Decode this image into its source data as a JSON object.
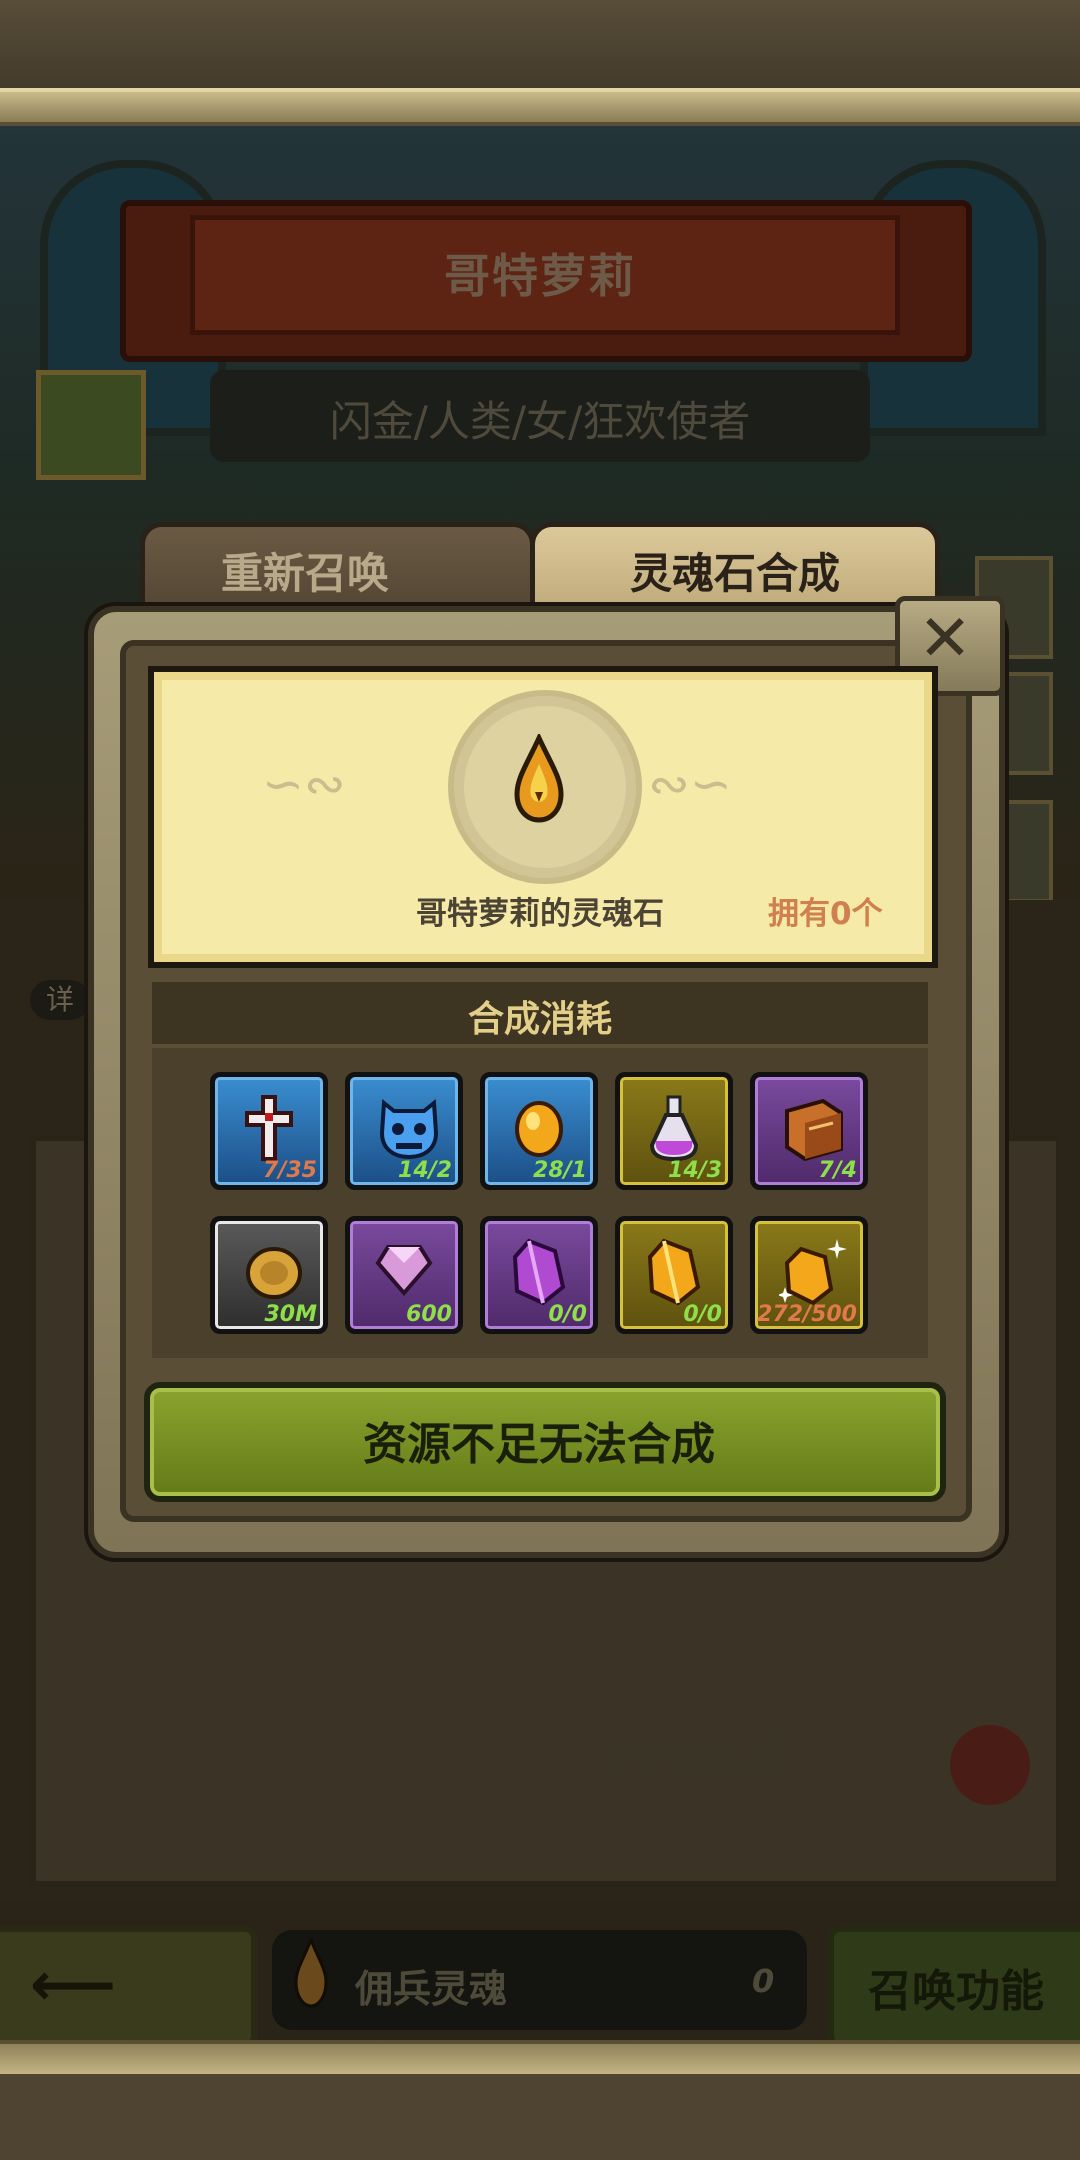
{
  "background": {
    "hero_name": "哥特萝莉",
    "hero_info": "闪金/人类/女/狂欢使者",
    "side_label": "详"
  },
  "tabs": {
    "resummon": "重新召唤",
    "soulstone_craft": "灵魂石合成"
  },
  "modal": {
    "close_label": "✕",
    "stone_name": "哥特萝莉的灵魂石",
    "owned_text": "拥有0个",
    "cost_header": "合成消耗",
    "craft_button": "资源不足无法合成"
  },
  "materials": [
    {
      "icon": "cross-icon",
      "rarity": "blue",
      "count": "7/35",
      "count_color": "red"
    },
    {
      "icon": "skull-icon",
      "rarity": "blue",
      "count": "14/2",
      "count_color": "green"
    },
    {
      "icon": "amber-gem-icon",
      "rarity": "blue",
      "count": "28/1",
      "count_color": "green"
    },
    {
      "icon": "potion-icon",
      "rarity": "gold",
      "count": "14/3",
      "count_color": "green"
    },
    {
      "icon": "book-icon",
      "rarity": "purple",
      "count": "7/4",
      "count_color": "green"
    },
    {
      "icon": "coin-icon",
      "rarity": "gray",
      "count": "30M",
      "count_color": "green"
    },
    {
      "icon": "diamond-icon",
      "rarity": "purple",
      "count": "600",
      "count_color": "green"
    },
    {
      "icon": "purple-crystal-icon",
      "rarity": "purple",
      "count": "0/0",
      "count_color": "green"
    },
    {
      "icon": "gold-crystal-icon",
      "rarity": "gold",
      "count": "0/0",
      "count_color": "green"
    },
    {
      "icon": "sparkle-gold-crystal-icon",
      "rarity": "gold",
      "count": "272/500",
      "count_color": "red"
    }
  ],
  "bottom_bar": {
    "back_arrow": "⟵",
    "soul_label": "佣兵灵魂",
    "soul_count": "0",
    "summon_button": "召唤功能"
  },
  "colors": {
    "craft_button": "#8aa42e",
    "owned_text": "#d08050",
    "parchment": "#f6eaa9"
  }
}
